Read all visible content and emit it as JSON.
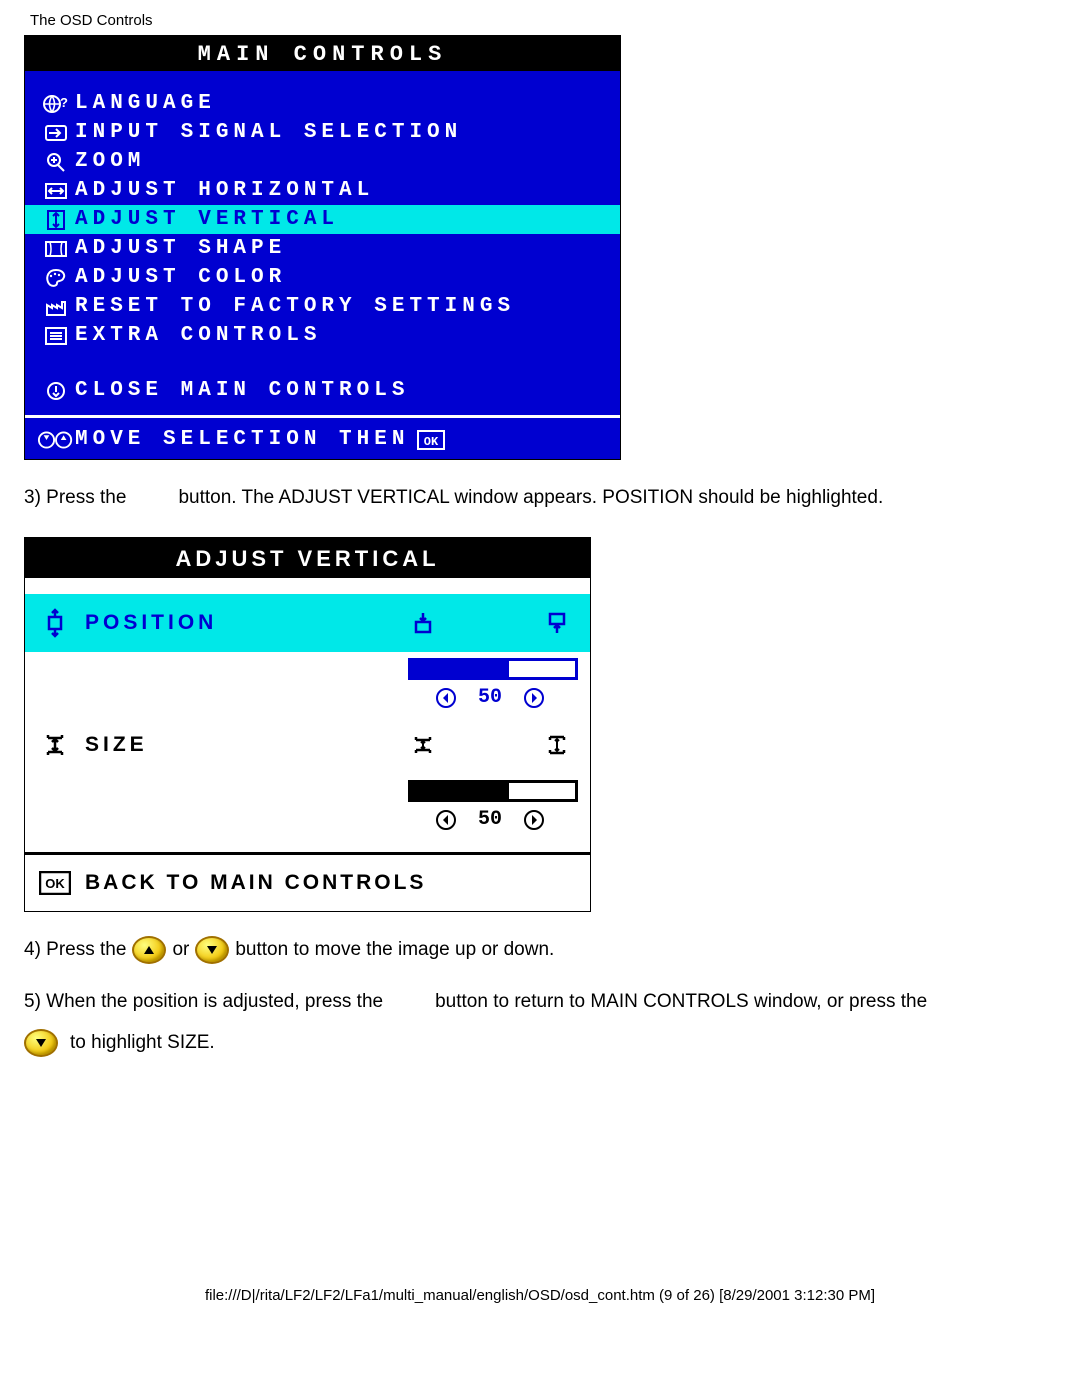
{
  "header": {
    "title": "The OSD Controls"
  },
  "main_controls": {
    "title": "MAIN CONTROLS",
    "items": [
      {
        "label": "LANGUAGE",
        "icon": "globe-question-icon",
        "selected": false
      },
      {
        "label": "INPUT SIGNAL SELECTION",
        "icon": "input-arrow-icon",
        "selected": false
      },
      {
        "label": "ZOOM",
        "icon": "magnifier-icon",
        "selected": false
      },
      {
        "label": "ADJUST HORIZONTAL",
        "icon": "horizontal-arrows-icon",
        "selected": false
      },
      {
        "label": "ADJUST VERTICAL",
        "icon": "vertical-arrows-icon",
        "selected": true
      },
      {
        "label": "ADJUST SHAPE",
        "icon": "shape-box-icon",
        "selected": false
      },
      {
        "label": "ADJUST COLOR",
        "icon": "palette-icon",
        "selected": false
      },
      {
        "label": "RESET TO FACTORY SETTINGS",
        "icon": "factory-icon",
        "selected": false
      },
      {
        "label": "EXTRA CONTROLS",
        "icon": "list-icon",
        "selected": false
      }
    ],
    "close": {
      "label": "CLOSE MAIN CONTROLS",
      "icon": "power-down-icon"
    },
    "footer": {
      "label": "MOVE SELECTION THEN",
      "ok_icon": "ok-box-icon"
    }
  },
  "step3": {
    "pre": "3) Press the",
    "post": "button. The ADJUST VERTICAL window appears. POSITION should be highlighted."
  },
  "adjust_vertical": {
    "title": "ADJUST VERTICAL",
    "position": {
      "label": "POSITION",
      "value": "50",
      "bar_pct": 60
    },
    "size": {
      "label": "SIZE",
      "value": "50",
      "bar_pct": 60
    },
    "back": {
      "label": "BACK TO MAIN CONTROLS"
    }
  },
  "step4": {
    "pre": "4) Press the",
    "mid": "or",
    "post": "button to move the image up or down."
  },
  "step5": {
    "pre": "5) When the position is adjusted, press the",
    "post": "button to return to MAIN CONTROLS window, or press the"
  },
  "step6": {
    "text": "to highlight SIZE."
  },
  "footer": {
    "text": "file:///D|/rita/LF2/LF2/LFa1/multi_manual/english/OSD/osd_cont.htm (9 of 26) [8/29/2001 3:12:30 PM]"
  }
}
